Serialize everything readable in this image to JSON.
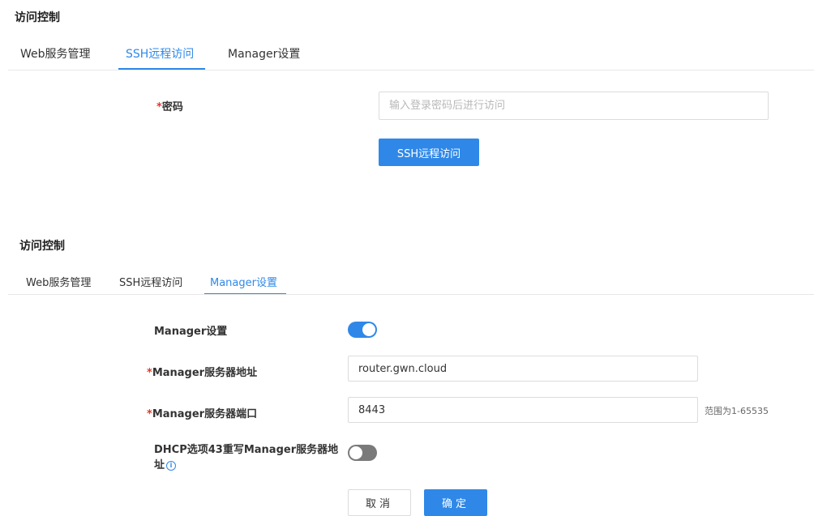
{
  "section1": {
    "title": "访问控制",
    "tabs": [
      {
        "label": "Web服务管理",
        "active": false
      },
      {
        "label": "SSH远程访问",
        "active": true
      },
      {
        "label": "Manager设置",
        "active": false
      }
    ],
    "password": {
      "required_mark": "*",
      "label": "密码",
      "placeholder": "输入登录密码后进行访问",
      "value": ""
    },
    "ssh_button_label": "SSH远程访问"
  },
  "section2": {
    "title": "访问控制",
    "tabs": [
      {
        "label": "Web服务管理",
        "active": false
      },
      {
        "label": "SSH远程访问",
        "active": false
      },
      {
        "label": "Manager设置",
        "active": true
      }
    ],
    "manager_enable": {
      "label": "Manager设置",
      "on": true
    },
    "server_address": {
      "required_mark": "*",
      "label": "Manager服务器地址",
      "value": "router.gwn.cloud"
    },
    "server_port": {
      "required_mark": "*",
      "label": "Manager服务器端口",
      "value": "8443",
      "hint": "范围为1-65535"
    },
    "dhcp_override": {
      "label_line1": "DHCP选项43重写Manager服务器地",
      "label_line2": "址",
      "on": false
    },
    "cancel_label": "取消",
    "confirm_label": "确定"
  },
  "colors": {
    "accent": "#2f88e8",
    "required": "#e0392b",
    "toggle_off": "#7a7a7a"
  },
  "icons": {
    "info": "info-circle-icon"
  }
}
